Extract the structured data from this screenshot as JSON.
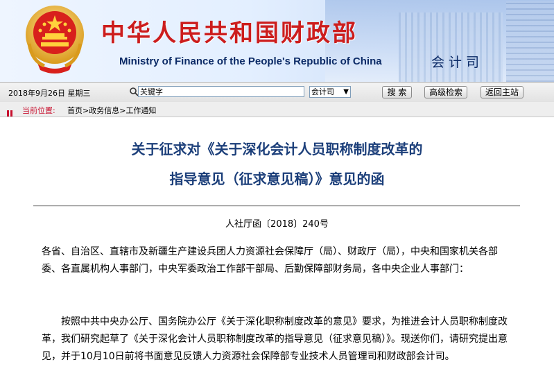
{
  "header": {
    "site_title": "中华人民共和国财政部",
    "site_subtitle": "Ministry of Finance of the People's Republic of China",
    "dept_name": "会计司"
  },
  "toolbar": {
    "date": "2018年9月26日   星期三",
    "search_placeholder": "关键字",
    "scope_selected": "会计司",
    "search_button": "搜 索",
    "advanced_button": "高级检索",
    "home_button": "返回主站"
  },
  "breadcrumb": {
    "label": "当前位置:",
    "items": [
      "首页",
      "政务信息",
      "工作通知"
    ],
    "separator": ">"
  },
  "article": {
    "title_line1": "关于征求对《关于深化会计人员职称制度改革的",
    "title_line2": "指导意见（征求意见稿）》意见的函",
    "doc_number": "人社厅函〔2018〕240号",
    "paragraph1": "各省、自治区、直辖市及新疆生产建设兵团人力资源社会保障厅（局）、财政厅（局），中央和国家机关各部委、各直属机构人事部门，中央军委政治工作部干部局、后勤保障部财务局，各中央企业人事部门：",
    "paragraph2": "按照中共中央办公厅、国务院办公厅《关于深化职称制度改革的意见》要求，为推进会计人员职称制度改革，我们研究起草了《关于深化会计人员职称制度改革的指导意见（征求意见稿）》。现送你们，请研究提出意见，并于10月10日前将书面意见反馈人力资源社会保障部专业技术人员管理司和财政部会计司。"
  },
  "colors": {
    "title_red": "#cc1d1d",
    "heading_blue": "#1c3f7a",
    "crumb_red": "#c8102e"
  },
  "icons": {
    "emblem": "national-emblem-icon",
    "search": "search-icon",
    "breadcrumb": "breadcrumb-marker-icon"
  }
}
